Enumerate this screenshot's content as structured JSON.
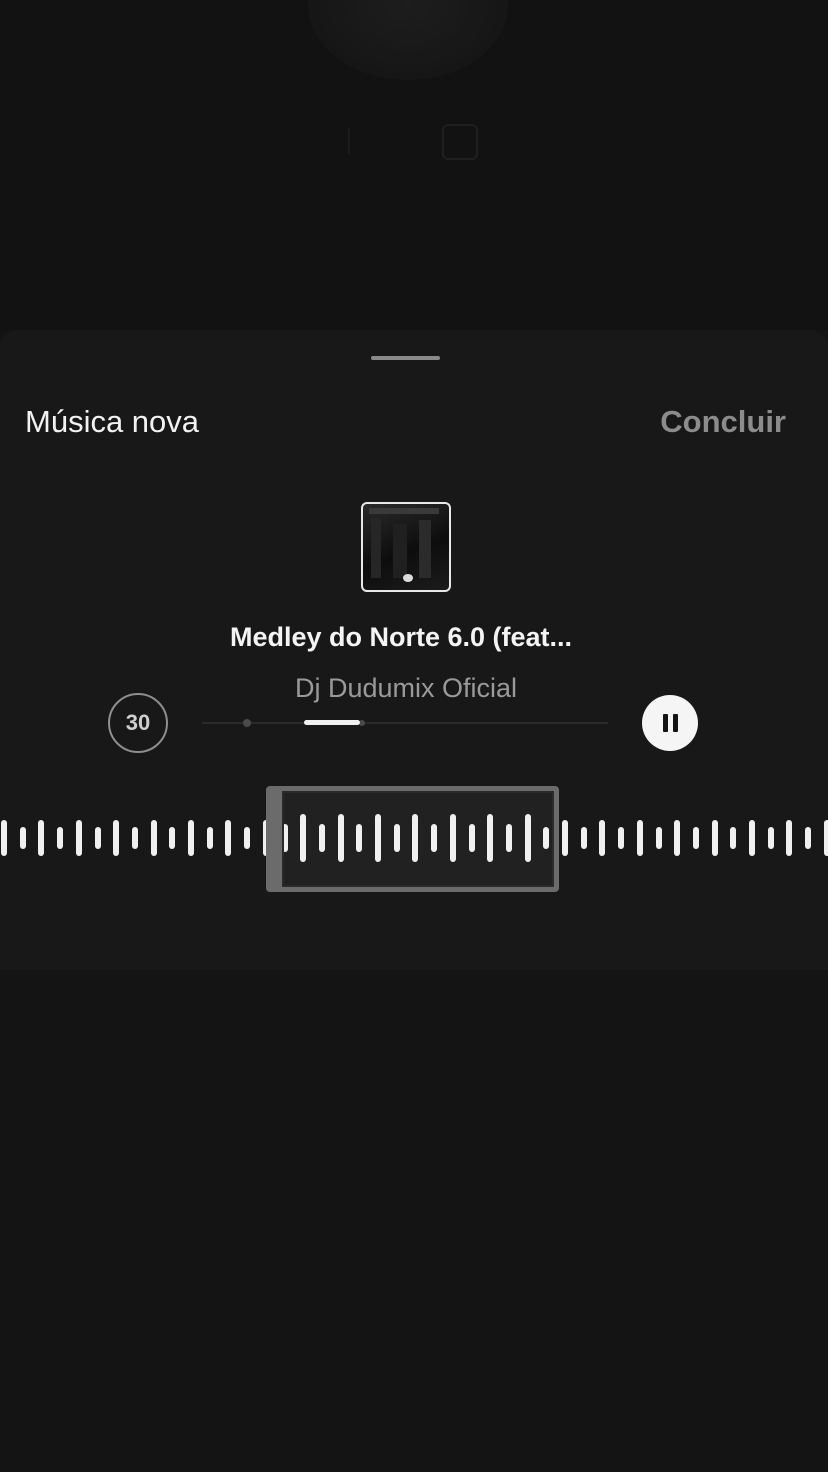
{
  "sheet": {
    "title": "Música nova",
    "done_label": "Concluir"
  },
  "track": {
    "title": "Medley do Norte 6.0 (feat...",
    "artist": "Dj Dudumix Oficial"
  },
  "clip": {
    "duration_label": "30",
    "segment_start_fraction": 0.25,
    "segment_end_fraction": 0.39
  },
  "icons": {
    "pause": "pause-icon",
    "album_art": "album-art-image",
    "grabber": "sheet-grabber"
  },
  "colors": {
    "background": "#141414",
    "sheet": "#181818",
    "text_primary": "#f2f2f2",
    "text_secondary": "#9a9a9a",
    "done_disabled": "#8c8c8c"
  }
}
